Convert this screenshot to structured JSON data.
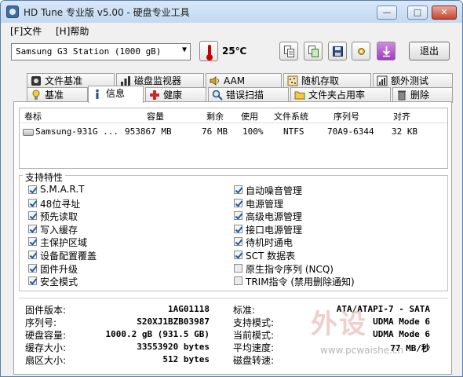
{
  "window": {
    "title": "HD Tune 专业版 v5.00 - 硬盘专业工具"
  },
  "window_buttons": {
    "minimize": "—",
    "maximize": "□",
    "close": "✕"
  },
  "menu": [
    {
      "label": "[F]文件"
    },
    {
      "label": "[H]帮助"
    }
  ],
  "toolbar": {
    "drive": "Samsung G3 Station (1000 gB)",
    "temperature": "25℃",
    "exit_label": "退出",
    "buttons": [
      "copy-info-icon",
      "copy-screen-icon",
      "save-icon",
      "options-icon",
      "download-icon"
    ]
  },
  "tabs_top": [
    {
      "label": "文件基准",
      "icon": "file-benchmark-icon"
    },
    {
      "label": "磁盘监视器",
      "icon": "disk-monitor-icon"
    },
    {
      "label": "AAM",
      "icon": "speaker-icon"
    },
    {
      "label": "随机存取",
      "icon": "random-access-icon"
    },
    {
      "label": "额外测试",
      "icon": "extra-tests-icon"
    }
  ],
  "tabs_bottom": [
    {
      "label": "基准",
      "icon": "benchmark-icon"
    },
    {
      "label": "信息",
      "icon": "info-icon"
    },
    {
      "label": "健康",
      "icon": "health-icon"
    },
    {
      "label": "错误扫描",
      "icon": "error-scan-icon"
    },
    {
      "label": "文件夹占用率",
      "icon": "folder-usage-icon"
    },
    {
      "label": "删除",
      "icon": "trash-icon"
    }
  ],
  "volume_table": {
    "headers": [
      "卷标",
      "容量",
      "剩余",
      "使用",
      "文件系统",
      "序列号",
      "对齐"
    ],
    "rows": [
      [
        "Samsung-931G ...",
        "953867 MB",
        "76 MB",
        "100%",
        "NTFS",
        "70A9-6344",
        "32 KB"
      ]
    ]
  },
  "features": {
    "title": "支持特性",
    "left": [
      {
        "label": "S.M.A.R.T",
        "checked": true
      },
      {
        "label": "48位寻址",
        "checked": true
      },
      {
        "label": "预先读取",
        "checked": true
      },
      {
        "label": "写入缓存",
        "checked": true
      },
      {
        "label": "主保护区域",
        "checked": true
      },
      {
        "label": "设备配置覆盖",
        "checked": true
      },
      {
        "label": "固件升级",
        "checked": true
      },
      {
        "label": "安全模式",
        "checked": true
      }
    ],
    "right": [
      {
        "label": "自动噪音管理",
        "checked": true
      },
      {
        "label": "电源管理",
        "checked": true
      },
      {
        "label": "高级电源管理",
        "checked": true
      },
      {
        "label": "接口电源管理",
        "checked": true
      },
      {
        "label": "待机时通电",
        "checked": true
      },
      {
        "label": "SCT 数据表",
        "checked": true
      },
      {
        "label": "原生指令序列 (NCQ)",
        "checked": false
      },
      {
        "label": "TRIM指令 (禁用删除通知)",
        "checked": false
      }
    ]
  },
  "info_left": [
    {
      "label": "固件版本:",
      "value": "1AG01118"
    },
    {
      "label": "序列号:",
      "value": "S20XJ1BZB03987"
    },
    {
      "label": "硬盘容量:",
      "value": "1000.2 gB (931.5 GB)"
    },
    {
      "label": "缓存大小:",
      "value": "33553920 bytes"
    },
    {
      "label": "扇区大小:",
      "value": "512 bytes"
    }
  ],
  "info_right": [
    {
      "label": "标准:",
      "value": "ATA/ATAPI-7 - SATA"
    },
    {
      "label": "支持模式:",
      "value": "UDMA Mode 6"
    },
    {
      "label": "当前模式:",
      "value": "UDMA Mode 6"
    },
    {
      "label": "平均速度:",
      "value": "77 MB/秒"
    },
    {
      "label": "磁盘转速:",
      "value": ""
    }
  ],
  "watermark": {
    "text": "外设",
    "url": "www.pcwaishe.cn"
  },
  "colors": {
    "accent": "#1d5d9e",
    "title_bg": "#c3d9f1",
    "close": "#c7442c"
  }
}
